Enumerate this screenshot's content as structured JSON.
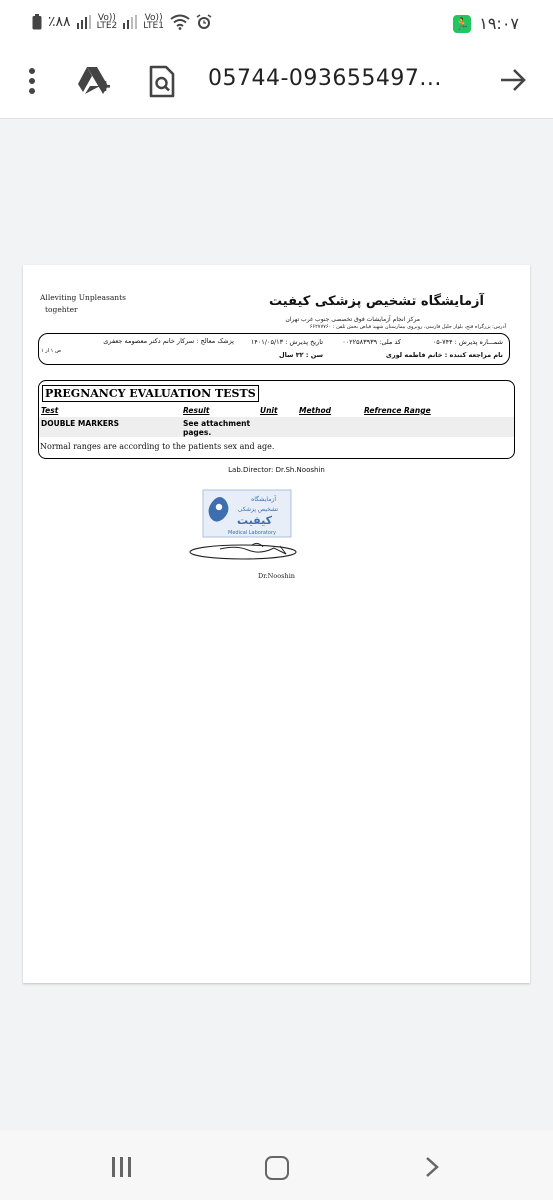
{
  "status_bar": {
    "battery_text": "٪۸۸",
    "lte2_label": "Vo))\nLTE2",
    "lte1_label": "Vo))\nLTE1",
    "time": "۱۹:۰۷"
  },
  "toolbar": {
    "title": "05744-093655497...",
    "icons": [
      "more-vert-icon",
      "drive-add-icon",
      "document-search-icon",
      "arrow-forward-icon"
    ]
  },
  "report": {
    "slogan_line1": "Alleviting Unpleasants",
    "slogan_line2": "togehter",
    "lab_name": "آزمایشگاه تشخیص پزشکی کیفیت",
    "lab_subtitle": "مرکز انجام آزمایشات فوق تخصصی جنوب غرب تهران",
    "lab_address": "آدرس: بزرگراه فتح، بلوار جلیل فارسی، روبروی بیمارستان شهید فیاض بخش تلفن : ۶۶۲۷۷۷۶۰",
    "admission_no": "شمـــاره پذیرش : ۷۴۴-۰۵",
    "national_code": "کد ملی: ۰۰۲۲۵۸۳۹۳۹",
    "admission_date": "تاریخ پذیرش : ۱۴۰۱/۰۵/۱۳",
    "physician": "پزشک معالج : سرکار خانم دکتر معصومه جعفری",
    "page_info": "ص ۱ از ۱",
    "patient": "نام مراجعه کننده : خانم فاطمه لوری",
    "age": "سن : ۳۲ سال",
    "section_title": "PREGNANCY EVALUATION TESTS",
    "columns": [
      "Test",
      "Result",
      "Unit",
      "Method",
      "Refrence Range"
    ],
    "rows": [
      {
        "test": "DOUBLE MARKERS",
        "result_line1": "See attachment",
        "result_line2": "pages.",
        "unit": "",
        "method": "",
        "range": ""
      }
    ],
    "note": "Normal ranges are according to the patients sex and age.",
    "director": "Lab.Director: Dr.Sh.Nooshin",
    "stamp_text_line1": "آزمایشگاه",
    "stamp_text_line2": "تشخیص پزشکی",
    "stamp_text_line3": "کیفیت",
    "stamp_text_en": "Medical Laboratory",
    "signature_name": "Dr.Nooshin"
  },
  "nav_bar": {
    "buttons": [
      "recent-apps-icon",
      "home-icon",
      "back-icon"
    ]
  },
  "colors": {
    "background": "#f1f3f4",
    "stamp_blue": "#3b6fb0",
    "battery_green": "#22c55e"
  }
}
